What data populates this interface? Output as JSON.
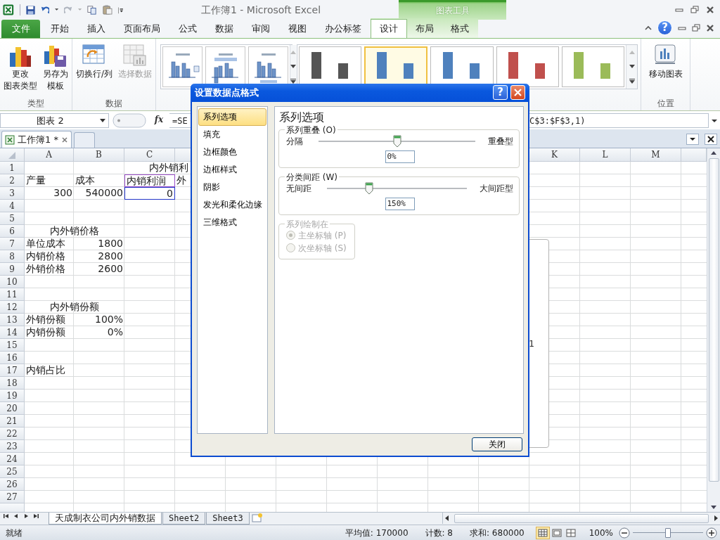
{
  "title_bar": {
    "title": "工作簿1 - Microsoft Excel",
    "context_group": "图表工具"
  },
  "ribbon_tabs": [
    {
      "label": "文件",
      "kind": "file",
      "selected": false
    },
    {
      "label": "开始",
      "kind": "normal",
      "selected": false
    },
    {
      "label": "插入",
      "kind": "normal",
      "selected": false
    },
    {
      "label": "页面布局",
      "kind": "normal",
      "selected": false
    },
    {
      "label": "公式",
      "kind": "normal",
      "selected": false
    },
    {
      "label": "数据",
      "kind": "normal",
      "selected": false
    },
    {
      "label": "审阅",
      "kind": "normal",
      "selected": false
    },
    {
      "label": "视图",
      "kind": "normal",
      "selected": false
    },
    {
      "label": "办公标签",
      "kind": "normal",
      "selected": false
    },
    {
      "label": "设计",
      "kind": "context",
      "selected": true
    },
    {
      "label": "布局",
      "kind": "context",
      "selected": false
    },
    {
      "label": "格式",
      "kind": "context",
      "selected": false
    }
  ],
  "ribbon_help": "?",
  "ribbon_groups": [
    {
      "kind": "buttons",
      "label": "类型",
      "buttons": [
        {
          "lines": [
            "更改",
            "图表类型"
          ],
          "disabled": false
        },
        {
          "lines": [
            "另存为",
            "模板"
          ],
          "disabled": false
        }
      ]
    },
    {
      "kind": "buttons",
      "label": "数据",
      "buttons": [
        {
          "lines": [
            "切换行/列"
          ],
          "disabled": false
        },
        {
          "lines": [
            "选择数据"
          ],
          "disabled": true
        }
      ]
    },
    {
      "kind": "layouts"
    },
    {
      "kind": "styles",
      "styles": [
        {
          "color": "#555555",
          "selected": false
        },
        {
          "color": "#4f81bd",
          "selected": true
        },
        {
          "color": "#4f81bd",
          "selected": false
        },
        {
          "color": "#c0504d",
          "selected": false
        },
        {
          "color": "#9bbb59",
          "selected": false
        }
      ]
    },
    {
      "kind": "buttons",
      "label": "位置",
      "buttons": [
        {
          "lines": [
            "移动图表"
          ],
          "disabled": false
        }
      ]
    }
  ],
  "formula_bar": {
    "name_box": "图表 2",
    "function_label": "fx",
    "formula_start": "=SE",
    "formula_end": "C$3:$F$3,1)"
  },
  "workbook_tabs": [
    {
      "label": "工作簿1 *",
      "selected": true
    }
  ],
  "sheet": {
    "columns_left": [
      "A",
      "B",
      "C"
    ],
    "columns_right": [
      "K",
      "L",
      "M"
    ],
    "rows": [
      {
        "label": "1",
        "cd": {
          "text": "内外销利",
          "kind": "heading"
        }
      },
      {
        "label": "2",
        "a": {
          "text": "产量",
          "kind": "text"
        },
        "b": {
          "text": "成本",
          "kind": "text"
        },
        "c": {
          "text": "内销利润",
          "kind": "text",
          "color": "#9b4fc8"
        },
        "d": {
          "text": "外",
          "kind": "text"
        }
      },
      {
        "label": "3",
        "a": {
          "text": "300",
          "kind": "number"
        },
        "b": {
          "text": "540000",
          "kind": "number"
        },
        "c": {
          "text": "0",
          "kind": "number",
          "color": "#2436c8"
        }
      },
      {
        "label": "4"
      },
      {
        "label": "5"
      },
      {
        "label": "6",
        "ab": {
          "text": "内外销价格",
          "kind": "heading"
        }
      },
      {
        "label": "7",
        "a": {
          "text": "单位成本",
          "kind": "text"
        },
        "b": {
          "text": "1800",
          "kind": "number"
        }
      },
      {
        "label": "8",
        "a": {
          "text": "内销价格",
          "kind": "text"
        },
        "b": {
          "text": "2800",
          "kind": "number"
        }
      },
      {
        "label": "9",
        "a": {
          "text": "外销价格",
          "kind": "text"
        },
        "b": {
          "text": "2600",
          "kind": "number"
        }
      },
      {
        "label": "10"
      },
      {
        "label": "11"
      },
      {
        "label": "12",
        "ab": {
          "text": "内外销份额",
          "kind": "heading"
        }
      },
      {
        "label": "13",
        "a": {
          "text": "外销份额",
          "kind": "text"
        },
        "b": {
          "text": "100%",
          "kind": "number"
        }
      },
      {
        "label": "14",
        "a": {
          "text": "内销份额",
          "kind": "text"
        },
        "b": {
          "text": "0%",
          "kind": "number"
        }
      },
      {
        "label": "15"
      },
      {
        "label": "16"
      },
      {
        "label": "17",
        "a": {
          "text": "内销占比",
          "kind": "text"
        }
      },
      {
        "label": "18"
      },
      {
        "label": "19"
      },
      {
        "label": "20"
      },
      {
        "label": "21"
      },
      {
        "label": "22"
      },
      {
        "label": "23"
      },
      {
        "label": "24"
      },
      {
        "label": "25"
      },
      {
        "label": "26"
      },
      {
        "label": "27"
      }
    ],
    "chart_object": {
      "label": "1"
    }
  },
  "sheet_tabs": [
    {
      "label": "天成制衣公司内外销数据",
      "selected": true
    },
    {
      "label": "Sheet2",
      "selected": false
    },
    {
      "label": "Sheet3",
      "selected": false
    }
  ],
  "status_bar": {
    "ready": "就绪",
    "average": "平均值: 170000",
    "count": "计数: 8",
    "sum": "求和: 680000",
    "views": [
      {
        "selected": true
      },
      {
        "selected": false
      },
      {
        "selected": false
      }
    ],
    "zoom": "100%",
    "zoom_slider": {
      "level": 0.5
    }
  },
  "dialog": {
    "title": "设置数据点格式",
    "help": "?",
    "nav": [
      {
        "label": "系列选项",
        "selected": true
      },
      {
        "label": "填充",
        "selected": false
      },
      {
        "label": "边框颜色",
        "selected": false
      },
      {
        "label": "边框样式",
        "selected": false
      },
      {
        "label": "阴影",
        "selected": false
      },
      {
        "label": "发光和柔化边缘",
        "selected": false
      },
      {
        "label": "三维格式",
        "selected": false
      }
    ],
    "panel_title": "系列选项",
    "groups": [
      {
        "kind": "slider",
        "legend": "系列重叠 (O)",
        "left": "分隔",
        "right": "重叠型",
        "level": 0.5,
        "value": "0%"
      },
      {
        "kind": "slider",
        "legend": "分类间距 (W)",
        "left": "无间距",
        "right": "大间距型",
        "level": 0.3,
        "value": "150%"
      },
      {
        "kind": "radios",
        "legend": "系列绘制在",
        "disabled": true,
        "options": [
          {
            "label": "主坐标轴 (P)",
            "selected": true
          },
          {
            "label": "次坐标轴 (S)",
            "selected": false
          }
        ]
      }
    ],
    "close_button": "关闭"
  }
}
